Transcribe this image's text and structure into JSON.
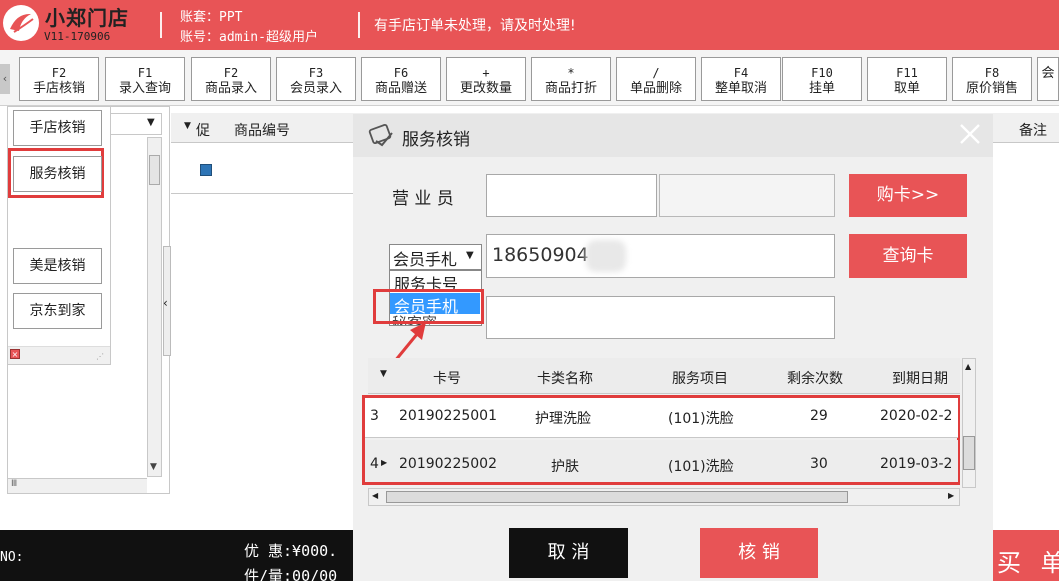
{
  "header": {
    "app_name": "小郑门店",
    "version": "V11-170906",
    "account_set": "账套：PPT",
    "account": "账号：admin-超级用户",
    "notice": "有手店订单未处理，请及时处理!"
  },
  "toolbar": {
    "buttons": [
      {
        "key": "F2",
        "label": "手店核销"
      },
      {
        "key": "F1",
        "label": "录入查询"
      },
      {
        "key": "F2",
        "label": "商品录入"
      },
      {
        "key": "F3",
        "label": "会员录入"
      },
      {
        "key": "F6",
        "label": "商品赠送"
      },
      {
        "key": "+",
        "label": "更改数量"
      },
      {
        "key": "*",
        "label": "商品打折"
      },
      {
        "key": "/",
        "label": "单品删除"
      },
      {
        "key": "F4",
        "label": "整单取消"
      },
      {
        "key": "F10",
        "label": "挂单"
      },
      {
        "key": "F11",
        "label": "取单"
      },
      {
        "key": "F8",
        "label": "原价销售"
      },
      {
        "key": "",
        "label": "会"
      }
    ]
  },
  "left_panel": {
    "buttons": [
      "手店核销",
      "服务核销",
      "美是核销",
      "京东到家"
    ]
  },
  "grid": {
    "col_promo": "促",
    "col_product_code": "商品编号",
    "col_note": "备注"
  },
  "dialog": {
    "title": "服务核销",
    "salesperson_label": "营 业 员",
    "buy_card": "购卡>>",
    "search_type_selected": "会员手札",
    "search_value": "18650904",
    "query_card": "查询卡",
    "dropdown_options": [
      "服务卡号",
      "会员手机"
    ],
    "dropdown_behind": "秘客密",
    "table": {
      "headers": [
        "卡号",
        "卡类名称",
        "服务项目",
        "剩余次数",
        "到期日期"
      ],
      "rows": [
        {
          "index": "3",
          "card_no": "20190225001",
          "card_type": "护理洗脸",
          "service": "(101)洗脸",
          "remaining": "29",
          "expiry": "2020-02-2"
        },
        {
          "index": "4",
          "card_no": "20190225002",
          "card_type": "护肤",
          "service": "(101)洗脸",
          "remaining": "30",
          "expiry": "2019-03-2"
        }
      ]
    },
    "cancel": "取 消",
    "confirm": "核 销"
  },
  "bottom": {
    "no_label": "NO:",
    "discount": "优 惠:¥000.",
    "qty": "件/量:00/00",
    "buy_button": "买 单"
  },
  "colors": {
    "brand_red": "#e85456",
    "highlight_red": "#e03c3c",
    "select_blue": "#3399ff"
  }
}
